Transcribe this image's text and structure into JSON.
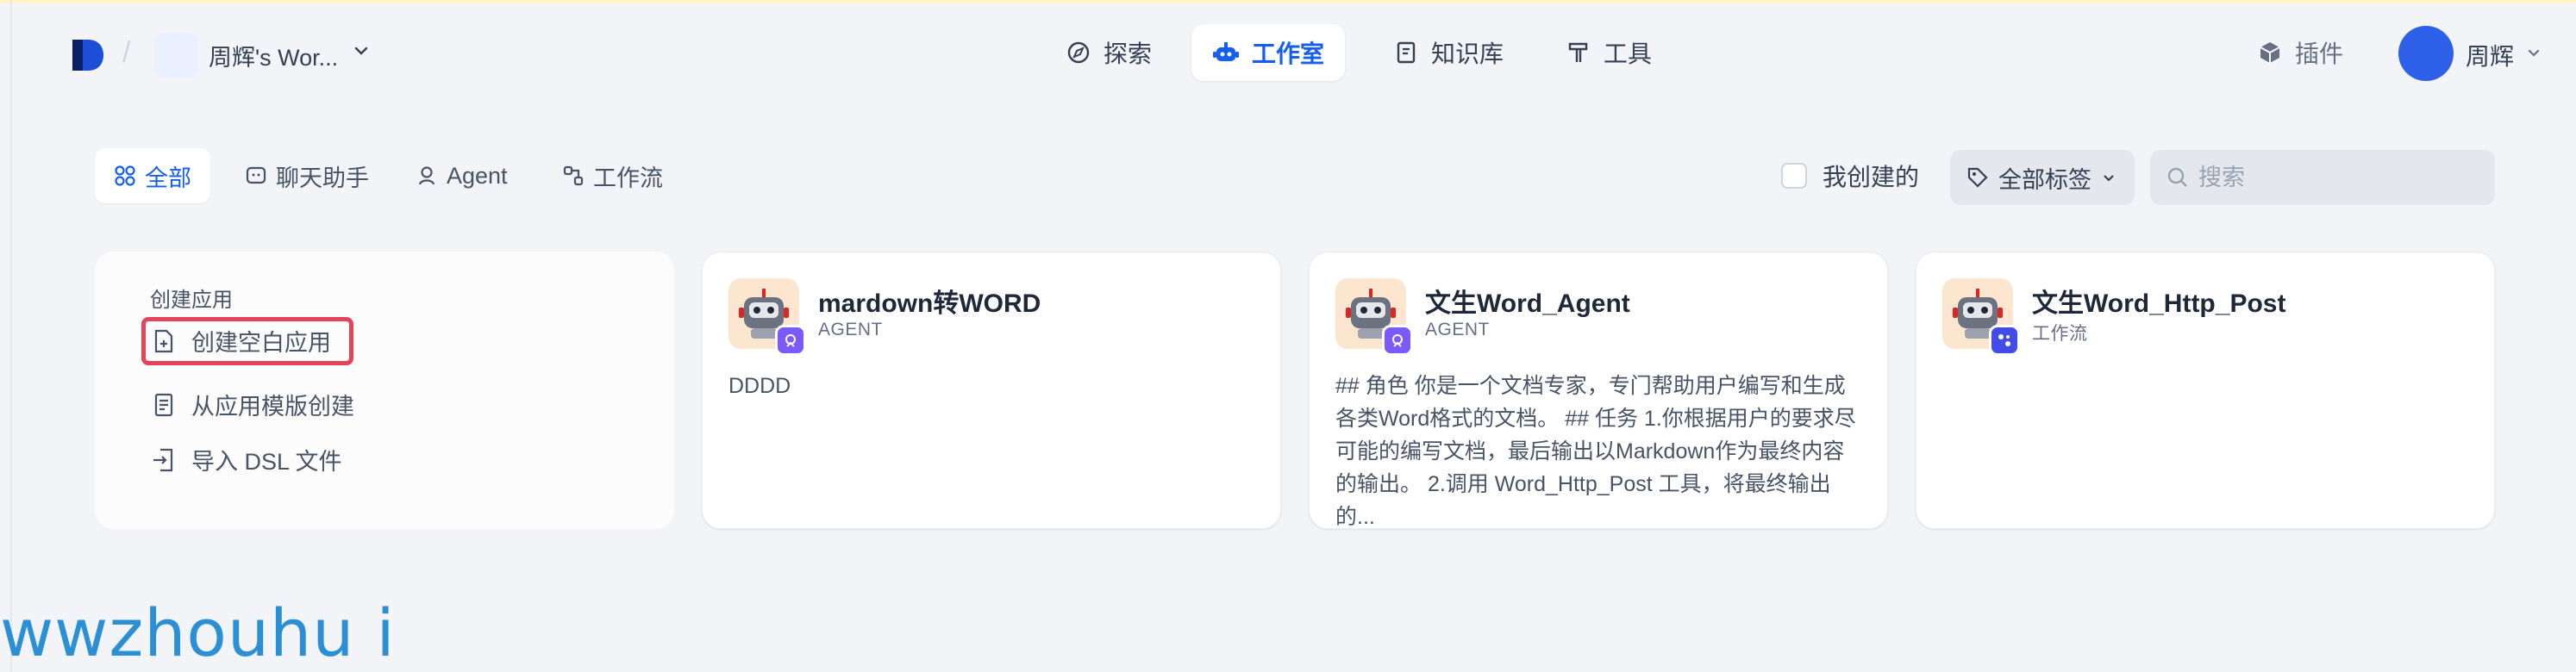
{
  "header": {
    "workspace_name": "周辉's Wor...",
    "nav": [
      {
        "label": "探索",
        "icon": "compass-icon",
        "active": false
      },
      {
        "label": "工作室",
        "icon": "robot-icon",
        "active": true
      },
      {
        "label": "知识库",
        "icon": "book-icon",
        "active": false
      },
      {
        "label": "工具",
        "icon": "hammer-icon",
        "active": false
      }
    ],
    "plugins_label": "插件",
    "user_name": "周辉"
  },
  "filters": {
    "tabs": [
      {
        "label": "全部",
        "icon": "grid-icon",
        "active": true
      },
      {
        "label": "聊天助手",
        "icon": "chat-icon",
        "active": false
      },
      {
        "label": "Agent",
        "icon": "agent-icon",
        "active": false
      },
      {
        "label": "工作流",
        "icon": "workflow-icon",
        "active": false
      }
    ],
    "mine_label": "我创建的",
    "mine_checked": false,
    "tags_label": "全部标签",
    "search_placeholder": "搜索"
  },
  "create": {
    "title": "创建应用",
    "items": [
      {
        "label": "创建空白应用",
        "icon": "file-plus-icon"
      },
      {
        "label": "从应用模版创建",
        "icon": "template-icon"
      },
      {
        "label": "导入 DSL 文件",
        "icon": "import-icon"
      }
    ]
  },
  "apps": [
    {
      "name": "mardown转WORD",
      "type": "AGENT",
      "badge_color": "#7a5af8",
      "description": "DDDD"
    },
    {
      "name": "文生Word_Agent",
      "type": "AGENT",
      "badge_color": "#7a5af8",
      "description": "## 角色 你是一个文档专家，专门帮助用户编写和生成各类Word格式的文档。 ## 任务 1.你根据用户的要求尽可能的编写文档，最后输出以Markdown作为最终内容的输出。 2.调用 Word_Http_Post 工具，将最终输出的..."
    },
    {
      "name": "文生Word_Http_Post",
      "type": "工作流",
      "badge_color": "#444ce7",
      "description": ""
    }
  ],
  "watermark": "wwzhouhu i",
  "colors": {
    "accent": "#155eef",
    "highlight": "#e5435a",
    "watermark": "#2b8fd6"
  }
}
